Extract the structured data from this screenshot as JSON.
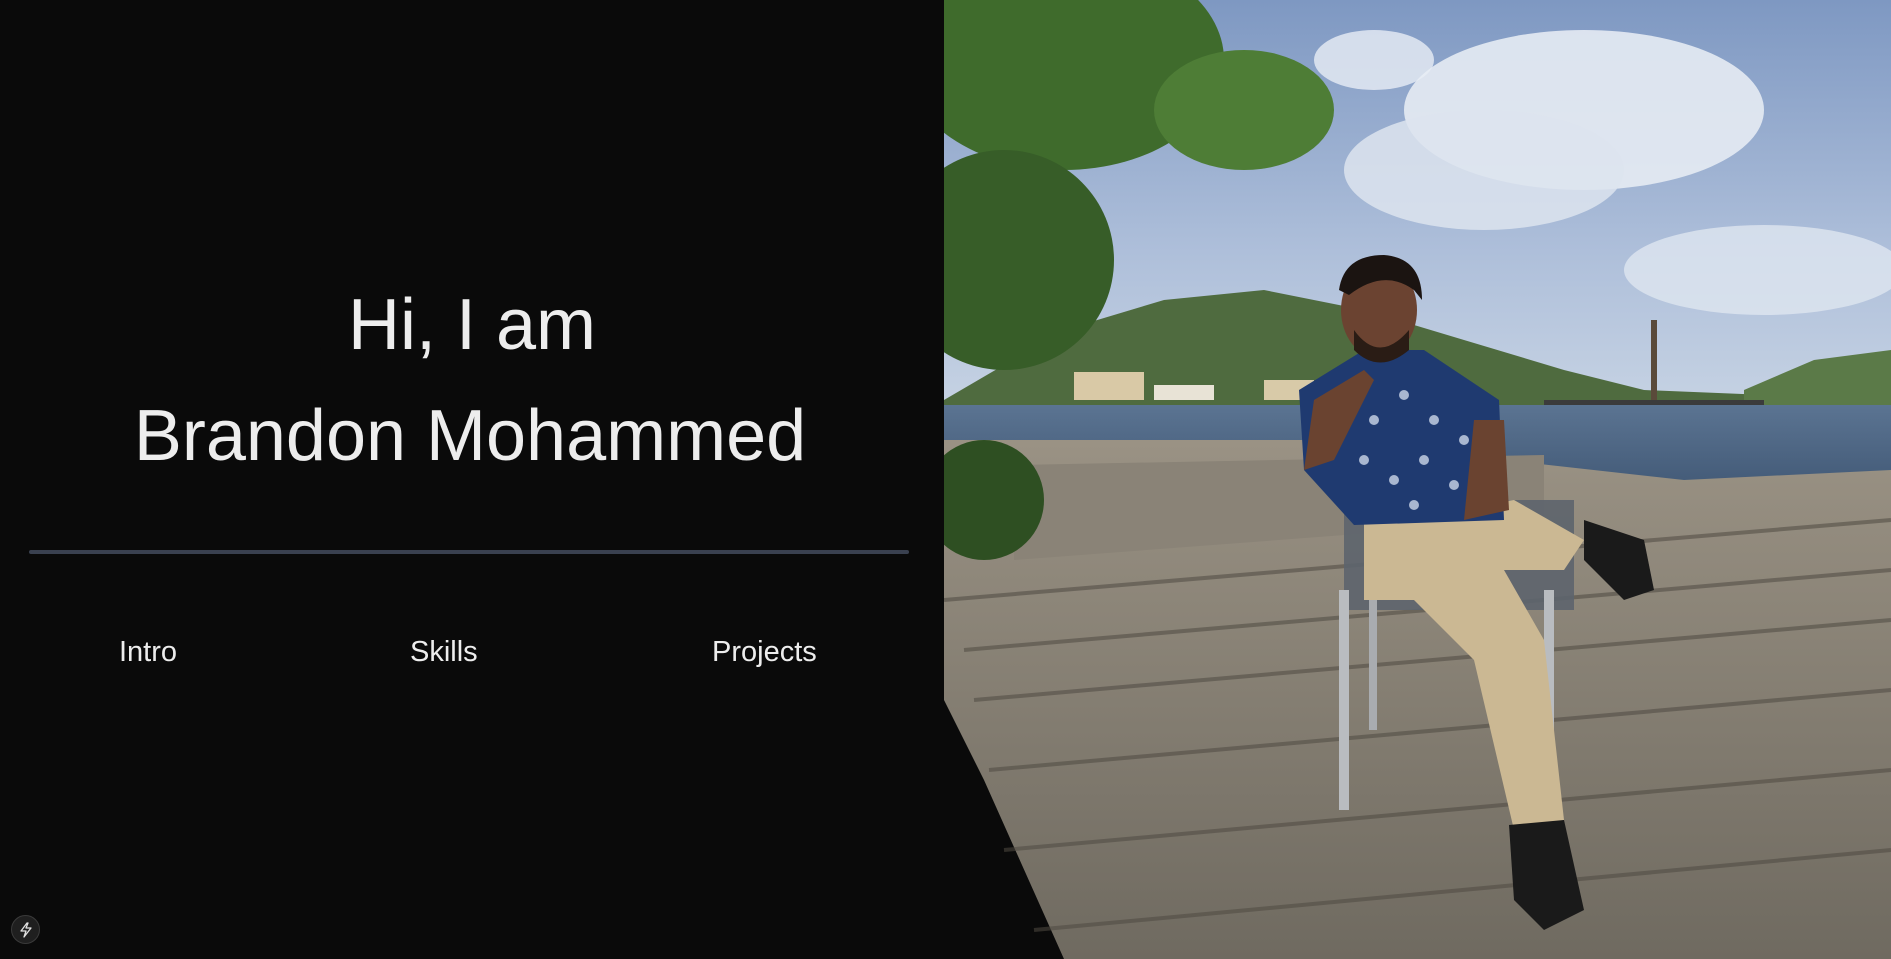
{
  "hero": {
    "greeting": "Hi, I am",
    "name": "Brandon Mohammed"
  },
  "nav": {
    "items": [
      {
        "label": "Intro"
      },
      {
        "label": "Skills"
      },
      {
        "label": "Projects"
      }
    ]
  },
  "dev_badge": {
    "icon": "lightning-bolt-icon"
  },
  "photo": {
    "subject": "portrait-photo"
  },
  "colors": {
    "background": "#0a0a0a",
    "text": "#ededed",
    "divider": "#3a4150"
  }
}
